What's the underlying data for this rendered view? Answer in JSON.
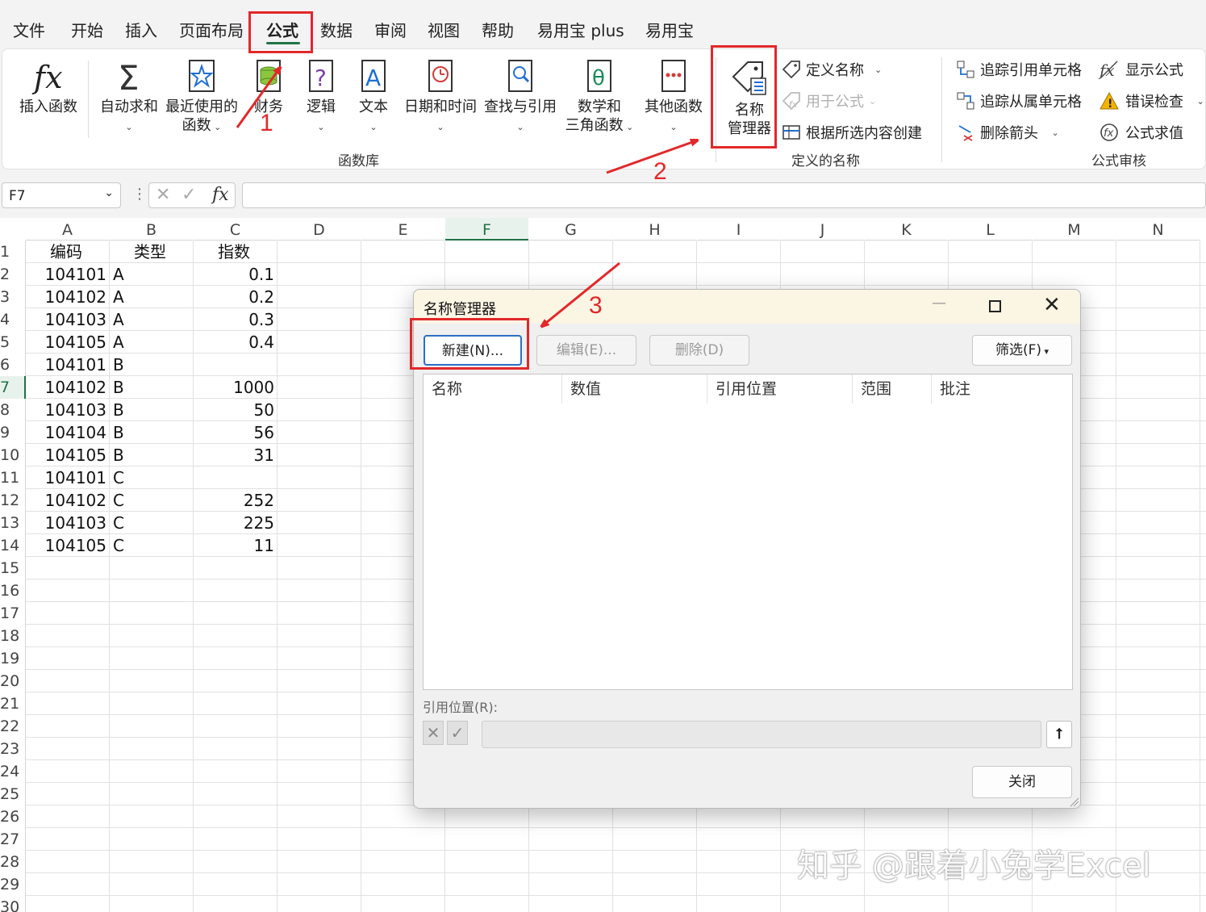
{
  "menu": {
    "items": [
      "文件",
      "开始",
      "插入",
      "页面布局",
      "公式",
      "数据",
      "审阅",
      "视图",
      "帮助",
      "易用宝 plus",
      "易用宝"
    ],
    "active": "公式"
  },
  "ribbon": {
    "function_library": {
      "label": "函数库",
      "insert_function": "插入函数",
      "autosum": "自动求和",
      "recent_line1": "最近使用的",
      "recent_line2": "函数",
      "finance": "财务",
      "logic": "逻辑",
      "text": "文本",
      "datetime": "日期和时间",
      "lookup": "查找与引用",
      "math_line1": "数学和",
      "math_line2": "三角函数",
      "other": "其他函数"
    },
    "defined_names": {
      "label": "定义的名称",
      "name_manager_line1": "名称",
      "name_manager_line2": "管理器",
      "define_name": "定义名称",
      "use_in_formula": "用于公式",
      "create_from_selection": "根据所选内容创建"
    },
    "auditing": {
      "label": "公式审核",
      "trace_precedents": "追踪引用单元格",
      "trace_dependents": "追踪从属单元格",
      "remove_arrows": "删除箭头",
      "show_formulas": "显示公式",
      "error_check": "错误检查",
      "evaluate": "公式求值"
    }
  },
  "formula_bar": {
    "name_box": "F7",
    "fx_label": "fx"
  },
  "sheet": {
    "columns": [
      "A",
      "B",
      "C",
      "D",
      "E",
      "F",
      "G",
      "H",
      "I",
      "J",
      "K",
      "L",
      "M",
      "N"
    ],
    "selected_column": "F",
    "selected_row": 7,
    "rows": [
      "1",
      "2",
      "3",
      "4",
      "5",
      "6",
      "7",
      "8",
      "9",
      "10",
      "11",
      "12",
      "13",
      "14",
      "15",
      "16",
      "17",
      "18",
      "19",
      "20",
      "21",
      "22",
      "23",
      "24",
      "25",
      "26",
      "27",
      "28",
      "29",
      "30"
    ],
    "header": [
      "编码",
      "类型",
      "指数"
    ],
    "data": [
      [
        "104101",
        "A",
        "0.1"
      ],
      [
        "104102",
        "A",
        "0.2"
      ],
      [
        "104103",
        "A",
        "0.3"
      ],
      [
        "104105",
        "A",
        "0.4"
      ],
      [
        "104101",
        "B",
        ""
      ],
      [
        "104102",
        "B",
        "1000"
      ],
      [
        "104103",
        "B",
        "50"
      ],
      [
        "104104",
        "B",
        "56"
      ],
      [
        "104105",
        "B",
        "31"
      ],
      [
        "104101",
        "C",
        ""
      ],
      [
        "104102",
        "C",
        "252"
      ],
      [
        "104103",
        "C",
        "225"
      ],
      [
        "104105",
        "C",
        "11"
      ]
    ]
  },
  "dialog": {
    "title": "名称管理器",
    "new_button": "新建(N)...",
    "edit_button": "编辑(E)...",
    "delete_button": "删除(D)",
    "filter_button": "筛选(F)",
    "columns": [
      "名称",
      "数值",
      "引用位置",
      "范围",
      "批注"
    ],
    "ref_label": "引用位置(R):",
    "close_button": "关闭"
  },
  "annotations": [
    "1",
    "2",
    "3"
  ],
  "watermark": "知乎 @跟着小兔学Excel",
  "colors": {
    "excel_green": "#217346",
    "annotation_red": "#e2282a",
    "dialog_title_bg": "#fbf5e4"
  }
}
